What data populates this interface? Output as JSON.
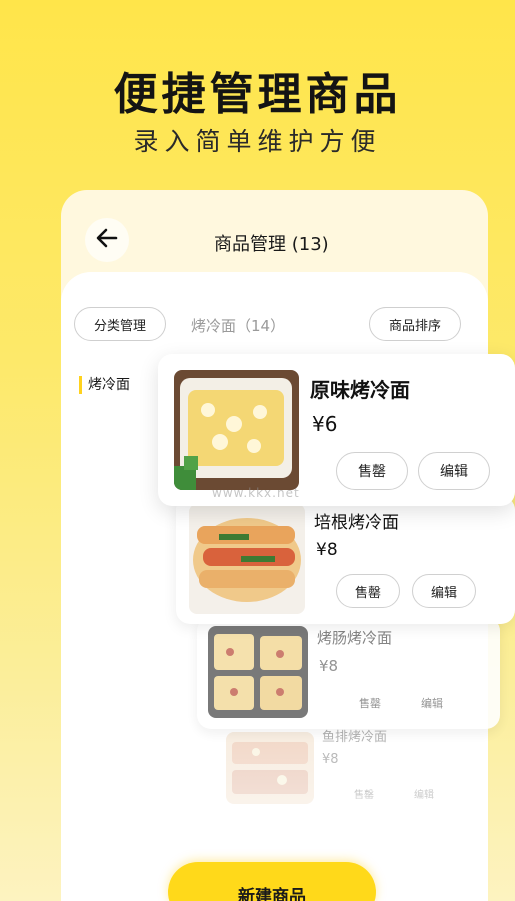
{
  "hero": {
    "title": "便捷管理商品",
    "subtitle": "录入简单维护方便"
  },
  "header": {
    "title": "商品管理 (13)"
  },
  "toolbar": {
    "category_button": "分类管理",
    "current_category": "烤冷面（14）",
    "sort_button": "商品排序"
  },
  "sidebar": {
    "items": [
      {
        "label": "烤冷面"
      }
    ]
  },
  "products": [
    {
      "name": "原味烤冷面",
      "price": "¥6",
      "sold_out_label": "售罄",
      "edit_label": "编辑"
    },
    {
      "name": "培根烤冷面",
      "price": "¥8",
      "sold_out_label": "售罄",
      "edit_label": "编辑"
    },
    {
      "name": "烤肠烤冷面",
      "price": "¥8",
      "sold_out_label": "售罄",
      "edit_label": "编辑"
    },
    {
      "name": "鱼排烤冷面",
      "price": "¥8",
      "sold_out_label": "售罄",
      "edit_label": "编辑"
    }
  ],
  "footer": {
    "new_product_button": "新建商品"
  },
  "watermark": {
    "text": "www.kkx.net"
  },
  "colors": {
    "accent": "#ffd91a",
    "background_top": "#ffe54a",
    "category_marker": "#ffd21e"
  },
  "icons": {
    "back": "arrow-left-icon"
  }
}
